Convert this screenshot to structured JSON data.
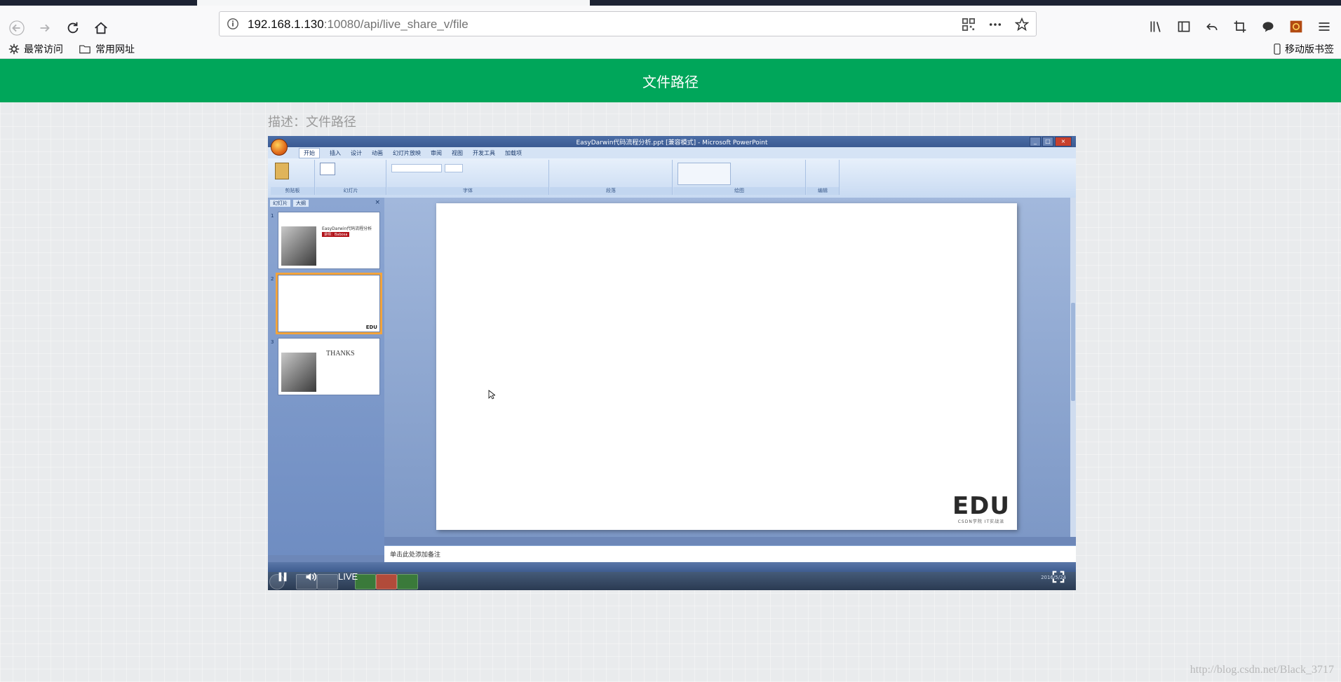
{
  "browser": {
    "url_host": "192.168.1.130",
    "url_rest": ":10080/api/live_share_v/file",
    "bookmarks": [
      "最常访问",
      "常用网址"
    ],
    "mobile_bookmarks": "移动版书签"
  },
  "page": {
    "banner_title": "文件路径",
    "description": "描述：文件路径"
  },
  "ppt": {
    "window_title": "EasyDarwin代码流程分析.ppt [兼容模式] - Microsoft PowerPoint",
    "tabs": [
      "开始",
      "插入",
      "设计",
      "动画",
      "幻灯片放映",
      "审阅",
      "视图",
      "开发工具",
      "加载项"
    ],
    "groups": [
      "剪贴板",
      "幻灯片",
      "字体",
      "段落",
      "绘图",
      "编辑"
    ],
    "left_tabs": [
      "幻灯片",
      "大纲"
    ],
    "thumb1_title": "EasyDarwin代码流程分析",
    "thumb1_author": "讲师：Babosa",
    "thumb3_title": "THANKS",
    "notes_placeholder": "单击此处添加备注",
    "slide_logo": "EDU",
    "slide_logo_sub": "CSDN学院  IT实战派",
    "tray_date": "2016/5/24"
  },
  "player": {
    "live_label": "LIVE",
    "state": "playing"
  },
  "watermark": "http://blog.csdn.net/Black_3717",
  "colors": {
    "banner": "#00a65a",
    "desc": "#9a9a9a"
  }
}
